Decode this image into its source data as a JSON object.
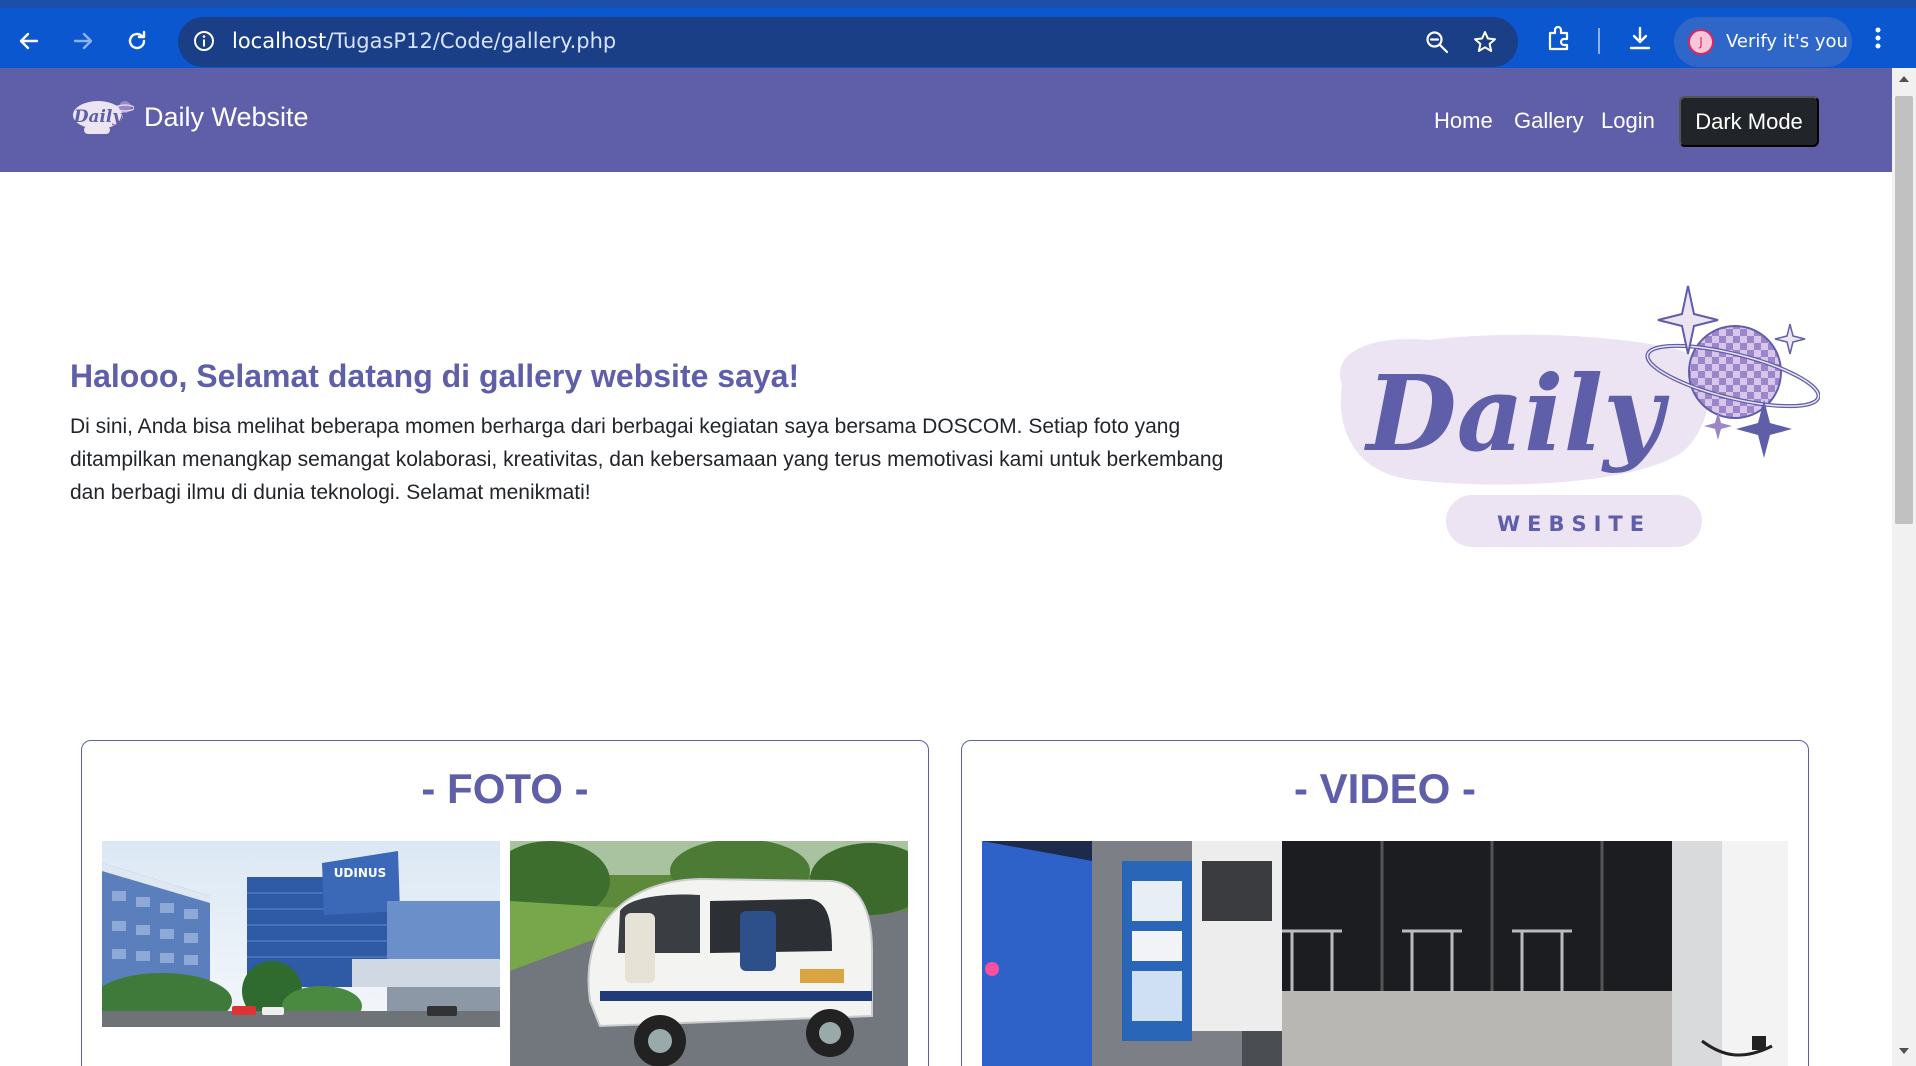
{
  "browser": {
    "url_host": "localhost",
    "url_path": "/TugasP12/Code/gallery.php",
    "profile_initial": "J",
    "verify_label": "Verify it's you",
    "icons": [
      "back-arrow-icon",
      "forward-arrow-icon",
      "reload-icon",
      "site-info-icon",
      "zoom-icon",
      "bookmark-star-icon",
      "extensions-icon",
      "download-icon",
      "kebab-menu-icon"
    ]
  },
  "navbar": {
    "brand": "Daily Website",
    "links": [
      "Home",
      "Gallery",
      "Login"
    ],
    "dark_mode_label": "Dark Mode"
  },
  "hero": {
    "title": "Halooo, Selamat datang di gallery website saya!",
    "text": "Di sini, Anda bisa melihat beberapa momen berharga dari berbagai kegiatan saya bersama DOSCOM. Setiap foto yang ditampilkan menangkap semangat kolaborasi, kreativitas, dan kebersamaan yang terus memotivasi kami untuk berkembang dan berbagi ilmu di dunia teknologi. Selamat menikmati!"
  },
  "logo": {
    "word": "Daily",
    "sub": "WEBSITE"
  },
  "cards": {
    "foto_title": "- FOTO -",
    "video_title": "- VIDEO -",
    "photo_1_sign": "UDINUS"
  },
  "colors": {
    "primary": "#5f5ea8",
    "chrome_blue": "#0b57d0",
    "dark_button": "#212529",
    "logo_lavender": "#ece3f3"
  }
}
